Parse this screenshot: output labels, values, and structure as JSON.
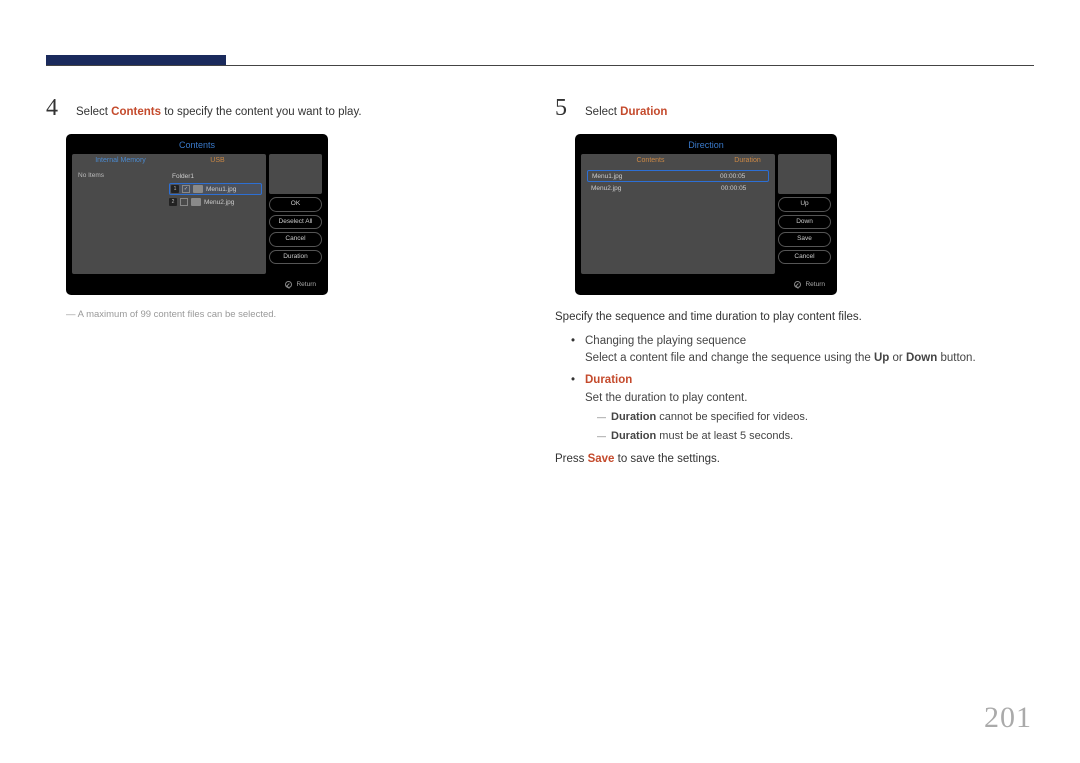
{
  "page_number": "201",
  "left": {
    "step_num": "4",
    "step_before": "Select ",
    "step_hl": "Contents",
    "step_after": " to specify the content you want to play.",
    "note": "A maximum of 99 content files can be selected.",
    "screen": {
      "title": "Contents",
      "col_left": "Internal Memory",
      "col_right": "USB",
      "no_items": "No Items",
      "folder": "Folder1",
      "file1_num": "1",
      "file1_name": "Menu1.jpg",
      "file2_num": "2",
      "file2_name": "Menu2.jpg",
      "btn_ok": "OK",
      "btn_deselect": "Deselect All",
      "btn_cancel": "Cancel",
      "btn_duration": "Duration",
      "return": "Return"
    }
  },
  "right": {
    "step_num": "5",
    "step_before": "Select ",
    "step_hl": "Duration",
    "screen": {
      "title": "Direction",
      "col_left": "Contents",
      "col_right": "Duration",
      "row1_name": "Menu1.jpg",
      "row1_dur": "00:00:05",
      "row2_name": "Menu2.jpg",
      "row2_dur": "00:00:05",
      "btn_up": "Up",
      "btn_down": "Down",
      "btn_save": "Save",
      "btn_cancel": "Cancel",
      "return": "Return"
    },
    "intro": "Specify the sequence and time duration to play content files.",
    "bullet1_title": "Changing the playing sequence",
    "bullet1_body_a": "Select a content file and change the sequence using the ",
    "bullet1_up": "Up",
    "bullet1_or": " or ",
    "bullet1_down": "Down",
    "bullet1_body_b": " button.",
    "bullet2_title": "Duration",
    "bullet2_body": "Set the duration to play content.",
    "dash1_hl": "Duration",
    "dash1_rest": " cannot be specified for videos.",
    "dash2_hl": "Duration",
    "dash2_rest": " must be at least 5 seconds.",
    "press_a": "Press ",
    "press_hl": "Save",
    "press_b": " to save the settings."
  }
}
